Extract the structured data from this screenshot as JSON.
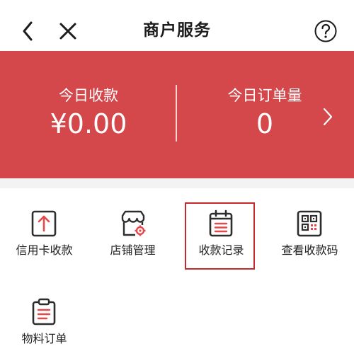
{
  "nav": {
    "title": "商户服务"
  },
  "summary": {
    "today_amount_label": "今日收款",
    "today_amount_value": "¥0.00",
    "today_orders_label": "今日订单量",
    "today_orders_value": "0"
  },
  "services": [
    {
      "label": "信用卡收款",
      "icon": "credit-card-upload-icon"
    },
    {
      "label": "店铺管理",
      "icon": "shop-settings-icon"
    },
    {
      "label": "收款记录",
      "icon": "calendar-record-icon"
    },
    {
      "label": "查看收款码",
      "icon": "qr-code-icon"
    },
    {
      "label": "物料订单",
      "icon": "clipboard-order-icon"
    }
  ],
  "colors": {
    "accent": "#d4474b",
    "icon_dark": "#2d2d2d",
    "icon_red": "#e4484a",
    "highlight": "#c7282c"
  }
}
